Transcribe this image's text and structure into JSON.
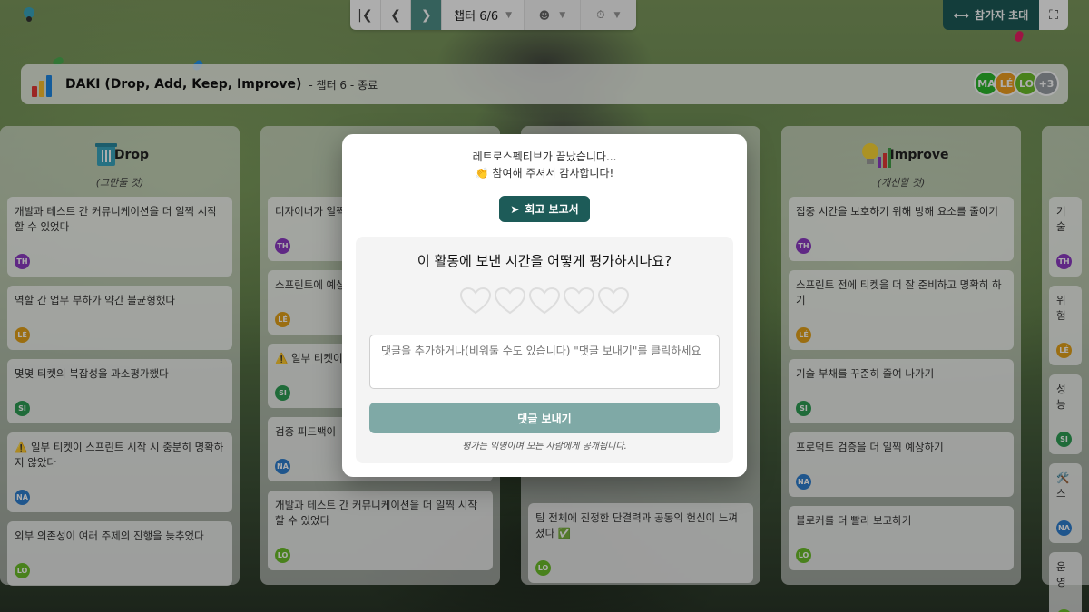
{
  "colors": {
    "accent": "#1d5b58",
    "next_button": "#4f8f88",
    "send_button": "#7fa9a6"
  },
  "toolbar": {
    "chapter_label": "챕터 6/6",
    "icons": [
      "first-page-icon",
      "prev-icon",
      "next-icon",
      "users-icon",
      "timer-icon"
    ]
  },
  "invite_label": "참가자 초대",
  "header": {
    "title": "DAKI (Drop, Add, Keep, Improve)",
    "subtitle": "- 챕터 6 - 종료",
    "avatars": [
      {
        "initials": "MA",
        "color": "#2db82d"
      },
      {
        "initials": "LÉ",
        "color": "#f0a020"
      },
      {
        "initials": "LO",
        "color": "#6cbf2a"
      },
      {
        "initials": "+3",
        "color": "#9aa0a6"
      }
    ]
  },
  "columns": [
    {
      "title": "Drop",
      "subtitle": "(그만둘 것)",
      "cards": [
        {
          "text": "개발과 테스트 간 커뮤니케이션을 더 일찍 시작할 수 있었다",
          "author": "TH",
          "color": "#8e3cc4"
        },
        {
          "text": "역할 간 업무 부하가 약간 불균형했다",
          "author": "LÉ",
          "color": "#e5a21a"
        },
        {
          "text": "몇몇 티켓의 복잡성을 과소평가했다",
          "author": "SI",
          "color": "#2e9e55"
        },
        {
          "text": "⚠️ 일부 티켓이 스프린트 시작 시 충분히 명확하지 않았다",
          "author": "NA",
          "color": "#2f7fd0"
        },
        {
          "text": "외부 의존성이 여러 주제의 진행을 늦추었다",
          "author": "LO",
          "color": "#6cbf2a"
        }
      ]
    },
    {
      "cards": [
        {
          "text": "디자이너가 일찍",
          "author": "TH",
          "color": "#8e3cc4"
        },
        {
          "text": "스프린트에 예상치 못한 가 없었다",
          "author": "LÉ",
          "color": "#e5a21a"
        },
        {
          "text": "⚠️ 일부 티켓이 확하지 않았다",
          "author": "SI",
          "color": "#2e9e55"
        },
        {
          "text": "검증 피드백이",
          "author": "NA",
          "color": "#2f7fd0"
        },
        {
          "text": "개발과 테스트 간 커뮤니케이션을 더 일찍 시작할 수 있었다",
          "author": "LO",
          "color": "#6cbf2a"
        }
      ]
    },
    {
      "cards": [
        {
          "text": "팀 전체에 진정한 단결력과 공동의 헌신이 느껴졌다 ✅",
          "author": "LO",
          "color": "#6cbf2a"
        }
      ]
    },
    {
      "title": "Improve",
      "subtitle": "(개선할 것)",
      "cards": [
        {
          "text": "집중 시간을 보호하기 위해 방해 요소를 줄이기",
          "author": "TH",
          "color": "#8e3cc4"
        },
        {
          "text": "스프린트 전에 티켓을 더 잘 준비하고 명확히 하기",
          "author": "LÉ",
          "color": "#e5a21a"
        },
        {
          "text": "기술 부채를 꾸준히 줄여 나가기",
          "author": "SI",
          "color": "#2e9e55"
        },
        {
          "text": "프로덕트 검증을 더 일찍 예상하기",
          "author": "NA",
          "color": "#2f7fd0"
        },
        {
          "text": "블로커를 더 빨리 보고하기",
          "author": "LO",
          "color": "#6cbf2a"
        }
      ]
    },
    {
      "cards": [
        {
          "text": "기술 부",
          "author": "TH",
          "color": "#8e3cc4"
        },
        {
          "text": "위험도가 여시키기",
          "author": "LÉ",
          "color": "#e5a21a"
        },
        {
          "text": "성능 문 값 추가",
          "author": "SI",
          "color": "#2e9e55"
        },
        {
          "text": "🛠️ 스 확히 하",
          "author": "NA",
          "color": "#2f7fd0"
        },
        {
          "text": "운영 환",
          "author": "LO",
          "color": "#6cbf2a"
        }
      ]
    }
  ],
  "modal": {
    "thanks_line1": "레트로스펙티브가 끝났습니다...",
    "thanks_line2": "👏 참여해 주셔서 감사합니다!",
    "report_label": "회고 보고서",
    "question": "이 활동에 보낸 시간을 어떻게 평가하시나요?",
    "rating": {
      "value": 0,
      "max": 5
    },
    "comment_placeholder": "댓글을 추가하거나(비워둘 수도 있습니다) \"댓글 보내기\"를 클릭하세요",
    "send_label": "댓글 보내기",
    "anon_note": "평가는 익명이며 모든 사람에게 공개됩니다."
  }
}
